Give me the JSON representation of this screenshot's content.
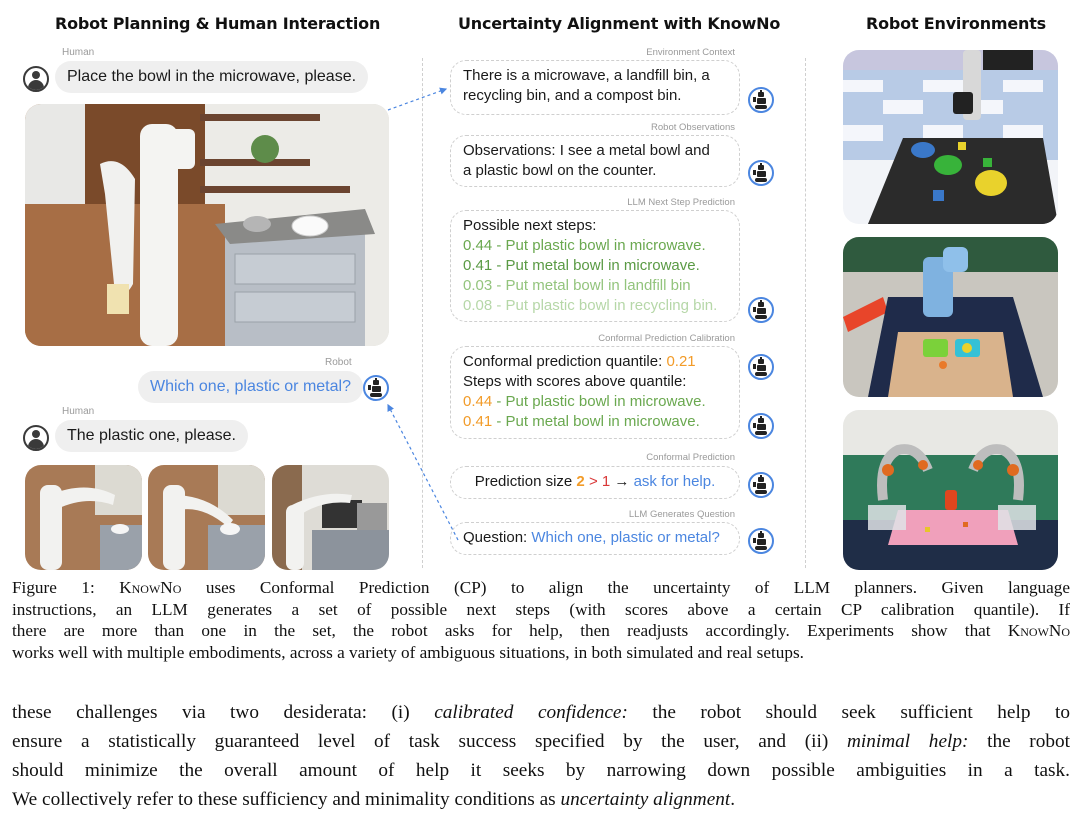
{
  "sections": {
    "left_title": "Robot Planning & Human Interaction",
    "middle_title": "Uncertainty Alignment with KnowNo",
    "right_title": "Robot Environments"
  },
  "chat": {
    "human_label": "Human",
    "robot_label": "Robot",
    "human_msg_1": "Place the bowl in the microwave, please.",
    "robot_msg": "Which one, plastic or metal?",
    "human_msg_2": "The plastic one, please."
  },
  "images": {
    "main_scene": "Mobile manipulator robot beside a grey drawer cabinet with a metal bowl and a plastic bowl on top",
    "sequence": [
      "Robot arm reaching toward bowls on counter",
      "Robot grasping plastic bowl",
      "Robot placing bowl into microwave"
    ],
    "environments": [
      "Simulated tabletop with colored bowls and blocks",
      "Real robot arm with green and blue bowls on wooden board",
      "Bimanual robot with pink mat, detergent bottle and bins"
    ]
  },
  "pipeline": {
    "environment_context": {
      "label": "Environment Context",
      "text_line1": "There is a microwave, a landfill bin, a",
      "text_line2": "recycling bin, and a compost bin."
    },
    "robot_observations": {
      "label": "Robot Observations",
      "text_line1": "Observations: I see a metal bowl and",
      "text_line2": "a plastic bowl on the counter."
    },
    "next_step_prediction": {
      "label": "LLM Next Step Prediction",
      "heading": "Possible next steps:",
      "options": [
        {
          "score": "0.44",
          "text": "Put plastic bowl in microwave."
        },
        {
          "score": "0.41",
          "text": "Put metal bowl in microwave."
        },
        {
          "score": "0.03",
          "text": "Put metal bowl in landfill bin"
        },
        {
          "score": "0.08",
          "text": "Put plastic bowl in recycling bin."
        }
      ]
    },
    "calibration": {
      "label": "Conformal Prediction Calibration",
      "quantile_text": "Conformal prediction quantile:",
      "quantile_value": "0.21",
      "above_text": "Steps with scores above quantile:",
      "kept": [
        {
          "score": "0.44",
          "text": "Put plastic bowl in microwave."
        },
        {
          "score": "0.41",
          "text": "Put metal bowl in microwave."
        }
      ]
    },
    "conformal_prediction": {
      "label": "Conformal Prediction",
      "prefix": "Prediction size",
      "size": "2",
      "gt": ">",
      "threshold": "1",
      "arrow": "→",
      "action": "ask for help."
    },
    "question": {
      "label": "LLM Generates Question",
      "prefix": "Question:",
      "text": "Which one, plastic or metal?"
    }
  },
  "caption": {
    "l1_a": "Figure 1: ",
    "l1_sc": "KnowNo",
    "l1_b": " uses Conformal Prediction (CP) to align the uncertainty of LLM planners.  Given language",
    "l2": "instructions, an LLM generates a set of possible next steps (with scores above a certain CP calibration quantile). If",
    "l3_a": "there are more than one in the set, the robot asks for help, then readjusts accordingly. Experiments show that ",
    "l3_sc": "KnowNo",
    "l4": "works well with multiple embodiments, across a variety of ambiguous situations, in both simulated and real setups."
  },
  "body": {
    "l1_a": "these challenges via two desiderata: (i) ",
    "l1_i": "calibrated confidence:",
    "l1_b": " the robot should seek sufficient help to",
    "l2_a": "ensure a statistically guaranteed level of task success specified by the user, and (ii) ",
    "l2_i": "minimal help:",
    "l2_b": " the robot",
    "l3": "should minimize the overall amount of help it seeks by narrowing down possible ambiguities in a task.",
    "l4_a": "We collectively refer to these sufficiency and minimality conditions as ",
    "l4_i": "uncertainty alignment",
    "l4_b": "."
  },
  "colors": {
    "accent_blue": "#4b86e0",
    "score_orange": "#f29b28",
    "compare_red": "#d93838",
    "green_strong": "#6aa84f",
    "green_faint": "#b6d7a8"
  }
}
